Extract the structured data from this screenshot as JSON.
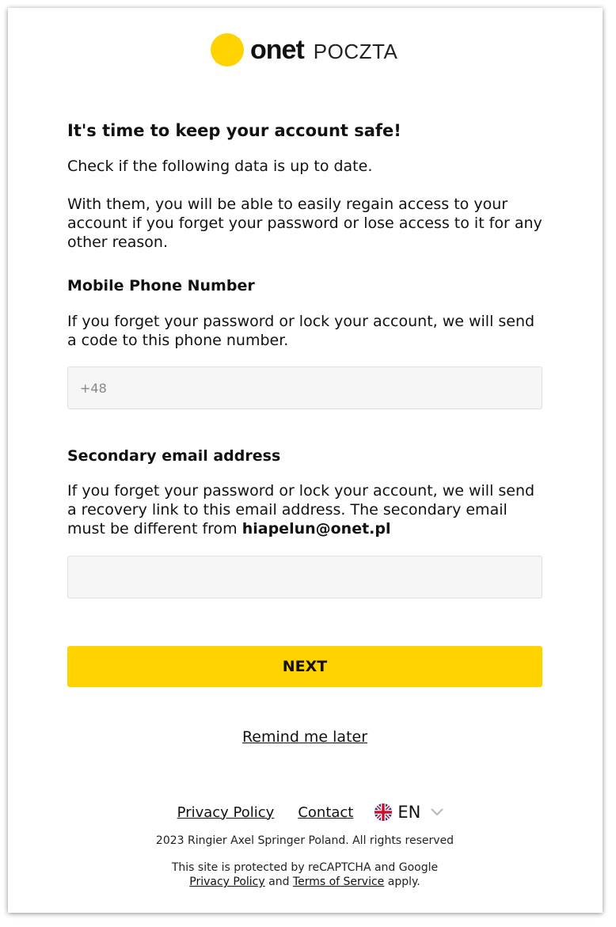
{
  "brand": {
    "logo_word": "onet",
    "logo_sub": "POCZTA",
    "accent_color": "#FFD200"
  },
  "main": {
    "title": "It's time to keep your account safe!",
    "intro_1": "Check if the following data is up to date.",
    "intro_2": "With them, you will be able to easily regain access to your account if you forget your password or lose access to it for any other reason."
  },
  "phone": {
    "label": "Mobile Phone Number",
    "description": "If you forget your password or lock your account, we will send a code to this phone number.",
    "placeholder": "+48",
    "value": ""
  },
  "email": {
    "label": "Secondary email address",
    "description_prefix": "If you forget your password or lock your account, we will send a recovery link to this email address. The secondary email must be different from ",
    "current_email": "hiapelun@onet.pl",
    "placeholder": "",
    "value": ""
  },
  "actions": {
    "next_label": "NEXT",
    "remind_label": "Remind me later"
  },
  "footer": {
    "privacy_label": "Privacy Policy",
    "contact_label": "Contact",
    "language_code": "EN",
    "language_icon": "uk-flag-icon",
    "copyright": "2023 Ringier Axel Springer Poland. All rights reserved",
    "recaptcha_line": "This site is protected by reCAPTCHA and Google",
    "recaptcha_privacy": "Privacy Policy",
    "recaptcha_and": "and",
    "recaptcha_terms": "Terms of Service",
    "recaptcha_apply": "apply."
  }
}
